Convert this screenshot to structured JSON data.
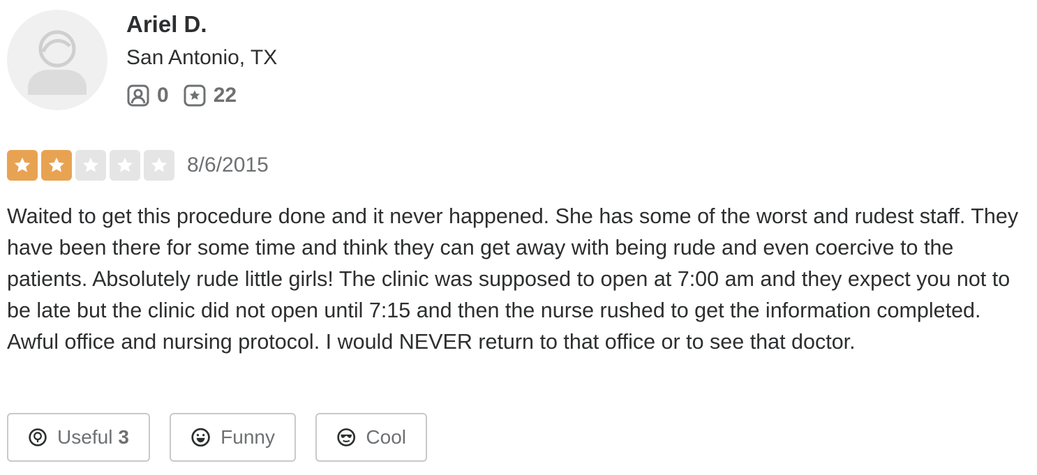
{
  "user": {
    "name": "Ariel D.",
    "location": "San Antonio, TX",
    "friends_count": "0",
    "reviews_count": "22",
    "avatar_icon": "default-user-avatar-icon"
  },
  "review": {
    "rating": 2,
    "max_rating": 5,
    "date": "8/6/2015",
    "text": "Waited to get this procedure done and it never happened. She has some of the worst and rudest staff. They have been there for some time and think they can get away with being rude and even coercive to the patients. Absolutely rude little girls!  The clinic was supposed to open at 7:00 am and they expect you not to be late but the clinic did not open until 7:15 and then the nurse rushed to get the information completed. Awful office and nursing protocol. I would NEVER return to that office or to see that doctor."
  },
  "votes": {
    "useful_label": "Useful",
    "useful_count": "3",
    "funny_label": "Funny",
    "cool_label": "Cool"
  },
  "colors": {
    "star_filled": "#e8a352",
    "star_empty": "#e5e5e6",
    "text": "#2d2e2f",
    "muted": "#6e7072"
  }
}
